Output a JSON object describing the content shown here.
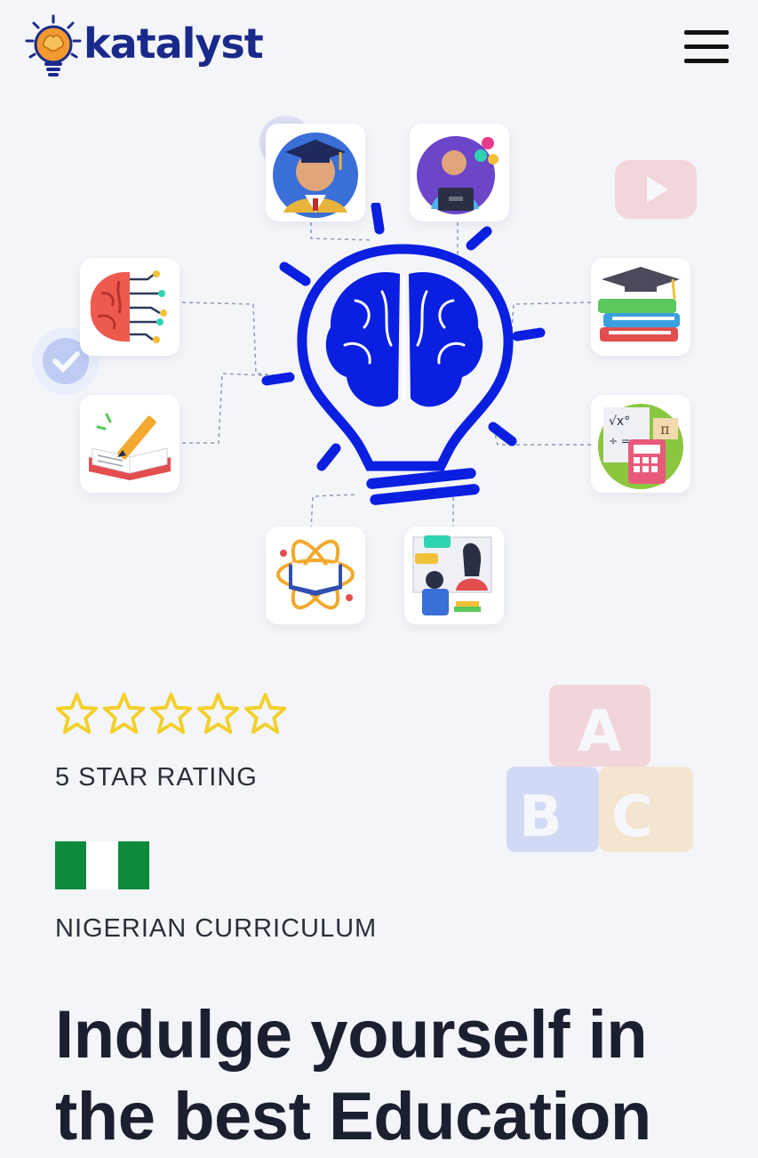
{
  "header": {
    "logo_text": "katalyst",
    "menu_icon": "hamburger-menu-icon"
  },
  "hero": {
    "center_icon": "lightbulb-brain-icon",
    "tiles": [
      {
        "name": "graduate-icon"
      },
      {
        "name": "online-teacher-icon"
      },
      {
        "name": "ai-brain-icon"
      },
      {
        "name": "books-graduation-cap-icon"
      },
      {
        "name": "writing-book-icon"
      },
      {
        "name": "math-calculator-icon"
      },
      {
        "name": "science-book-atom-icon"
      },
      {
        "name": "classroom-teacher-icon"
      }
    ],
    "decorations": [
      "play-button-icon",
      "check-badge-icon",
      "abc-blocks-icon"
    ]
  },
  "rating": {
    "stars": 5,
    "max_stars": 5,
    "label": "5 STAR RATING",
    "star_color": "#f2d02a"
  },
  "curriculum": {
    "label": "NIGERIAN CURRICULUM",
    "flag_colors": [
      "#0d8a3c",
      "#ffffff",
      "#0d8a3c"
    ]
  },
  "headline": {
    "text": "Indulge yourself in the best Education"
  },
  "colors": {
    "brand": "#1a2a8a",
    "accent_blue": "#0a1fe0",
    "background": "#f4f5f9"
  }
}
